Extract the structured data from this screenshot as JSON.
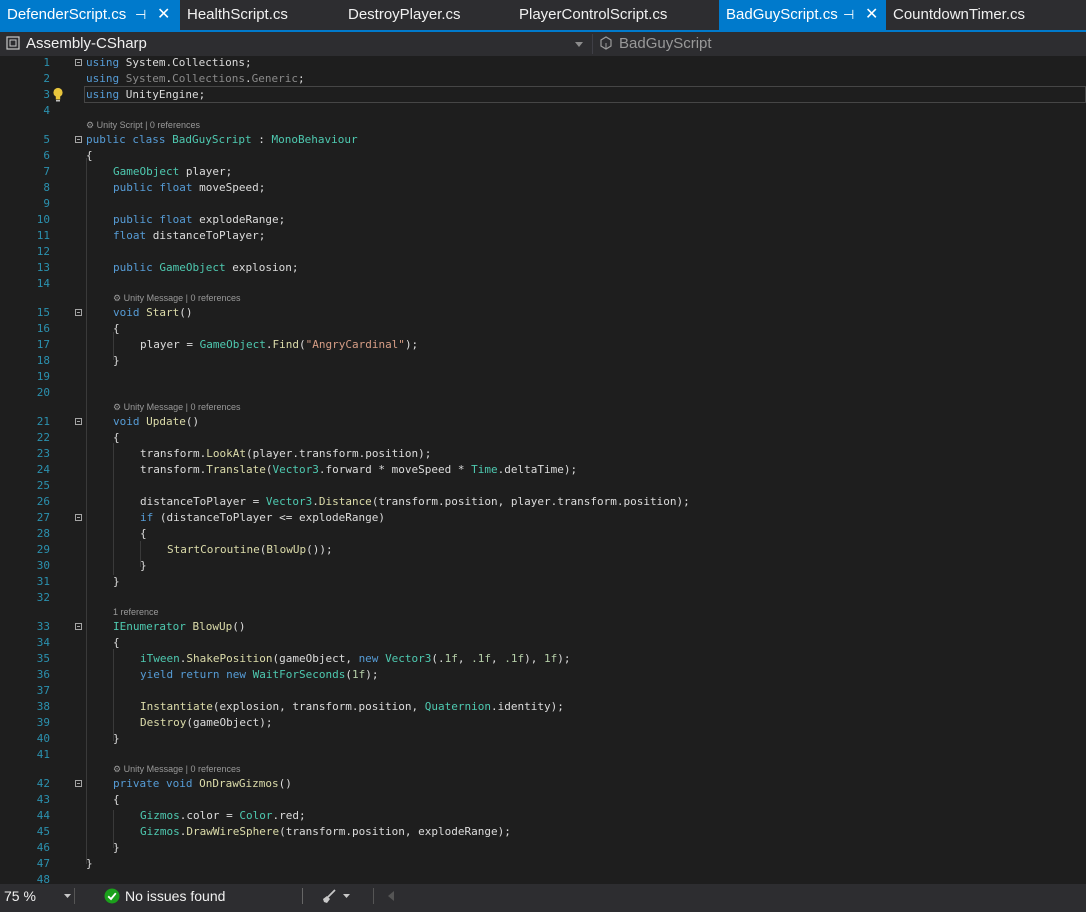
{
  "tabs": [
    {
      "label": "DefenderScript.cs",
      "active": true,
      "pinned": true
    },
    {
      "label": "HealthScript.cs"
    },
    {
      "label": "DestroyPlayer.cs"
    },
    {
      "label": "PlayerControlScript.cs"
    },
    {
      "label": "BadGuyScript.cs",
      "active": true,
      "pinned": true
    },
    {
      "label": "CountdownTimer.cs"
    }
  ],
  "navbar": {
    "project": "Assembly-CSharp",
    "type": "BadGuyScript"
  },
  "editor": {
    "line_numbers": [
      "1",
      "2",
      "3",
      "4",
      "5",
      "6",
      "7",
      "8",
      "9",
      "10",
      "11",
      "12",
      "13",
      "14",
      "15",
      "16",
      "17",
      "18",
      "19",
      "20",
      "21",
      "22",
      "23",
      "24",
      "25",
      "26",
      "27",
      "28",
      "29",
      "30",
      "31",
      "32",
      "33",
      "34",
      "35",
      "36",
      "37",
      "38",
      "39",
      "40",
      "41",
      "42",
      "43",
      "44",
      "45",
      "46",
      "47",
      "48"
    ],
    "codelens": {
      "class": "Unity Script | 0 references",
      "start": "Unity Message | 0 references",
      "update": "Unity Message | 0 references",
      "blowup": "1 reference",
      "gizmos": "Unity Message | 0 references"
    },
    "code": {
      "l1": "using System.Collections;",
      "l2": "using System.Collections.Generic;",
      "l3": "using UnityEngine;",
      "l5": "public class BadGuyScript : MonoBehaviour",
      "l6": "{",
      "l7": "GameObject player;",
      "l8": "public float moveSpeed;",
      "l10": "public float explodeRange;",
      "l11": "float distanceToPlayer;",
      "l13": "public GameObject explosion;",
      "l15": "void Start()",
      "l16": "{",
      "l17": "player = GameObject.Find(\"AngryCardinal\");",
      "l18": "}",
      "l21": "void Update()",
      "l22": "{",
      "l23": "transform.LookAt(player.transform.position);",
      "l24": "transform.Translate(Vector3.forward * moveSpeed * Time.deltaTime);",
      "l26": "distanceToPlayer = Vector3.Distance(transform.position, player.transform.position);",
      "l27": "if (distanceToPlayer <= explodeRange)",
      "l28": "{",
      "l29": "StartCoroutine(BlowUp());",
      "l30": "}",
      "l31": "}",
      "l33": "IEnumerator BlowUp()",
      "l34": "{",
      "l35": "iTween.ShakePosition(gameObject, new Vector3(.1f, .1f, .1f), 1f);",
      "l36": "yield return new WaitForSeconds(1f);",
      "l38": "Instantiate(explosion, transform.position, Quaternion.identity);",
      "l39": "Destroy(gameObject);",
      "l40": "}",
      "l42": "private void OnDrawGizmos()",
      "l43": "{",
      "l44": "Gizmos.color = Color.red;",
      "l45": "Gizmos.DrawWireSphere(transform.position, explodeRange);",
      "l46": "}",
      "l47": "}"
    }
  },
  "statusbar": {
    "zoom": "75 %",
    "issues": "No issues found"
  },
  "colors": {
    "accent": "#007acc",
    "keyword": "#569cd6",
    "type": "#4ec9b0",
    "string": "#d69d85",
    "number": "#b5cea8",
    "method": "#dcdcaa",
    "line_number": "#2b91af",
    "ok_green": "#1ba01b"
  },
  "icons": [
    "pin-icon",
    "close-icon",
    "project-icon",
    "class-icon",
    "lightbulb-icon",
    "codelens-icon",
    "check-icon",
    "brush-icon",
    "dropdown-arrow-icon"
  ]
}
